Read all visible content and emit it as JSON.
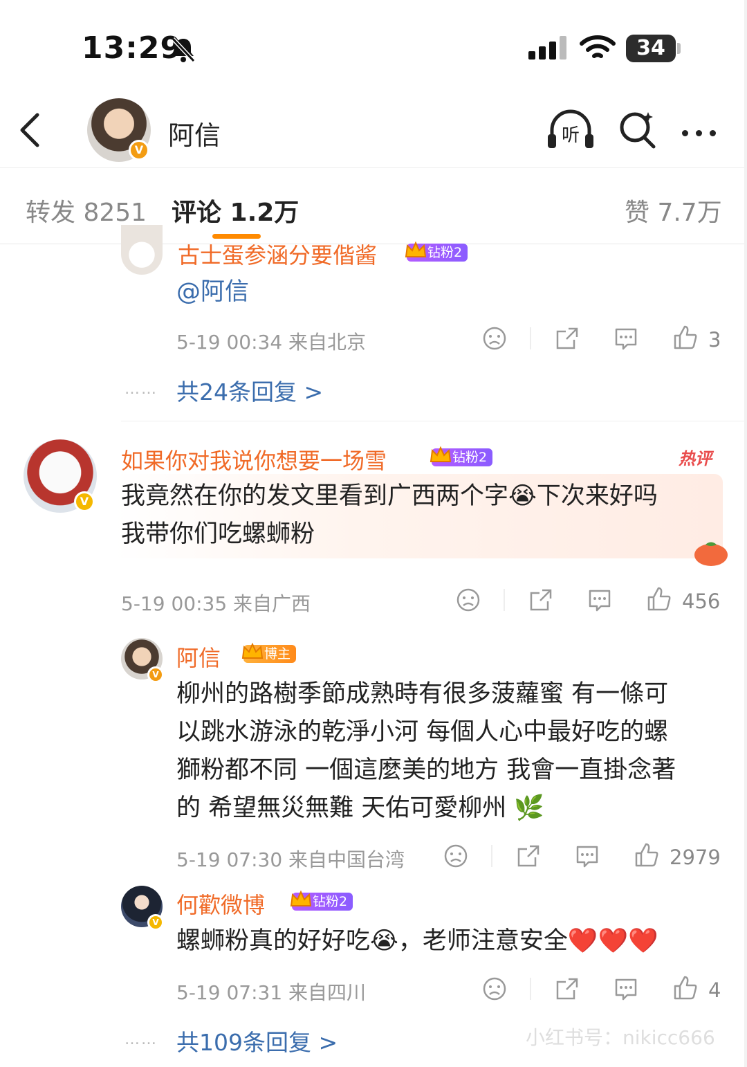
{
  "status_bar": {
    "time": "13:29",
    "battery": "34"
  },
  "header": {
    "title": "阿信",
    "listen_label": "听"
  },
  "tabs": [
    {
      "label": "转发 8251"
    },
    {
      "label": "评论 1.2万"
    },
    {
      "label": "赞 7.7万"
    }
  ],
  "comments": [
    {
      "name": "古士蛋参涵分要偕酱",
      "badge": "钻粉2",
      "text": "@阿信",
      "meta": "5-19 00:34 来自北京",
      "likes": "3",
      "replies": "共24条回复 >"
    },
    {
      "name": "如果你对我说你想要一场雪",
      "badge": "钻粉2",
      "hot_label": "热评",
      "text_line1": "我竟然在你的发文里看到广西两个字😭下次来好吗",
      "text_line2": "我带你们吃螺蛳粉",
      "meta": "5-19 00:35 来自广西",
      "likes": "456"
    }
  ],
  "replies": [
    {
      "name": "阿信",
      "badge": "博主",
      "lines": [
        "柳州的路樹季節成熟時有很多菠蘿蜜  有一條可",
        "以跳水游泳的乾淨小河  每個人心中最好吃的螺",
        "獅粉都不同  一個這麼美的地方  我會一直掛念著",
        "的  希望無災無難  天佑可愛柳州 🌿"
      ],
      "meta": "5-19 07:30 来自中国台湾",
      "likes": "2979"
    },
    {
      "name": "何歡微博",
      "badge": "钻粉2",
      "text": "螺蛳粉真的好好吃😭，老师注意安全❤️❤️❤️",
      "meta": "5-19 07:31 来自四川",
      "likes": "4"
    }
  ],
  "more_replies": "共109条回复 >",
  "more_dots": "……",
  "watermark": "小红书号：nikicc666",
  "colors": {
    "accent": "#ff8a00",
    "name": "#f06a27",
    "link": "#3b6dad"
  }
}
